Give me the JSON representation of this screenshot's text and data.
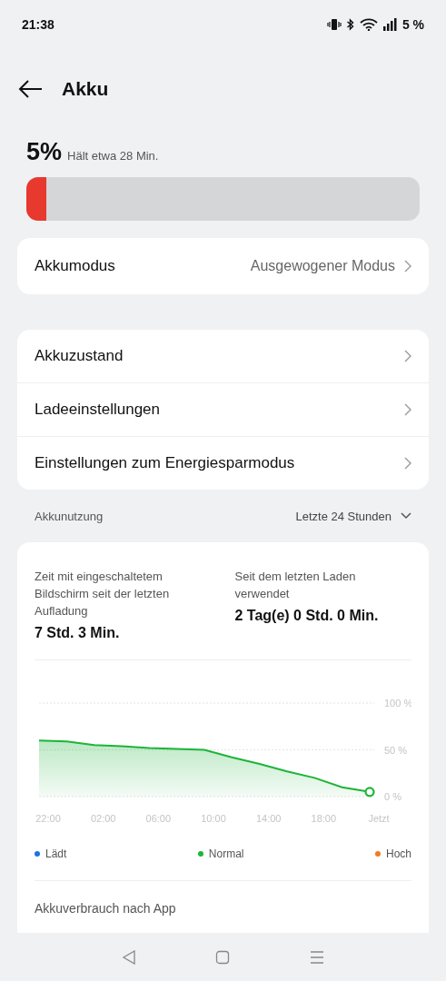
{
  "status_bar": {
    "time": "21:38",
    "battery_text": "5 %"
  },
  "header": {
    "title": "Akku"
  },
  "battery": {
    "percent": "5%",
    "estimate": "Hält etwa 28 Min.",
    "level": 0.05
  },
  "mode_card": {
    "label": "Akkumodus",
    "value": "Ausgewogener Modus"
  },
  "settings": [
    {
      "label": "Akkuzustand"
    },
    {
      "label": "Ladeeinstellungen"
    },
    {
      "label": "Einstellungen zum Energiesparmodus"
    }
  ],
  "usage": {
    "title": "Akkunutzung",
    "range": "Letzte 24 Stunden",
    "stats": [
      {
        "label": "Zeit mit eingeschaltetem Bildschirm seit der letzten Aufladung",
        "value": "7 Std. 3 Min."
      },
      {
        "label": "Seit dem letzten Laden verwendet",
        "value": "2 Tag(e) 0 Std. 0 Min."
      }
    ],
    "chart_data": {
      "type": "area",
      "categories": [
        "22:00",
        null,
        "02:00",
        null,
        "06:00",
        null,
        "10:00",
        null,
        "14:00",
        null,
        "18:00",
        null,
        "Jetzt"
      ],
      "series": [
        {
          "color": "#1db43a",
          "values": [
            60,
            59,
            55,
            54,
            52,
            51,
            50,
            42,
            35,
            27,
            20,
            10,
            5
          ]
        }
      ],
      "ylim": [
        0,
        100
      ],
      "yticks": [
        {
          "value": 100,
          "label": "100 %"
        },
        {
          "value": 50,
          "label": "50 %"
        },
        {
          "value": 0,
          "label": "0 %"
        }
      ]
    },
    "legend": [
      {
        "label": "Lädt",
        "color": "#1a73e8"
      },
      {
        "label": "Normal",
        "color": "#1db43a"
      },
      {
        "label": "Hoch",
        "color": "#f47a1f"
      }
    ],
    "app_usage_title": "Akkuverbrauch nach App"
  }
}
